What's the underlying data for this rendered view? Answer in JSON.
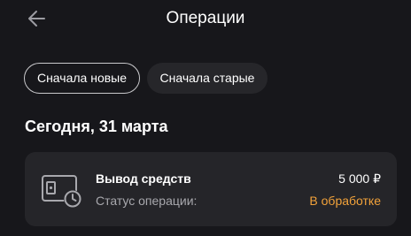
{
  "header": {
    "back_icon": "arrow-left-icon",
    "title": "Операции"
  },
  "sort_chips": [
    {
      "label": "Сначала новые",
      "selected": true
    },
    {
      "label": "Сначала старые",
      "selected": false
    }
  ],
  "date_group": {
    "label": "Сегодня, 31 марта"
  },
  "operation": {
    "icon": "wallet-withdraw-clock-icon",
    "title": "Вывод средств",
    "amount": "5 000 ₽",
    "status_label": "Статус операции:",
    "status_value": "В обработке",
    "status_color": "#f2a23a"
  },
  "colors": {
    "background": "#17171b",
    "card": "#252529",
    "accent": "#f2a23a"
  }
}
